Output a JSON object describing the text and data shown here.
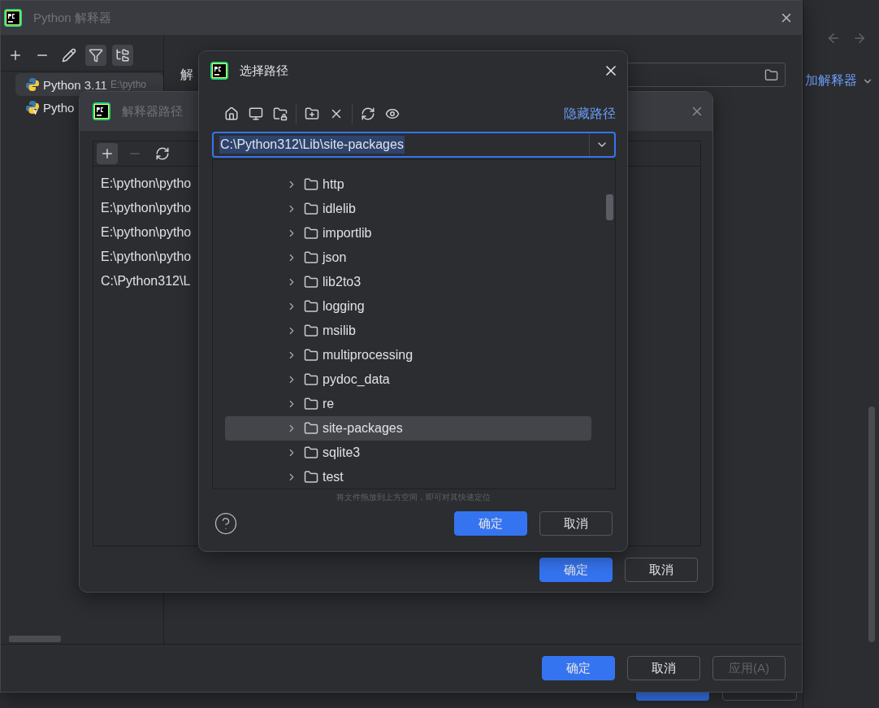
{
  "background": {
    "add_link": "加解释器"
  },
  "main_dialog": {
    "title": "Python 解释器",
    "active": false,
    "toolbar": [
      {
        "kind": "add",
        "selected": false
      },
      {
        "kind": "remove",
        "selected": false
      },
      {
        "kind": "edit",
        "selected": false
      },
      {
        "kind": "filter",
        "selected": true
      },
      {
        "kind": "tree",
        "selected": true
      }
    ],
    "interpreters": [
      {
        "name": "Python 3.11",
        "path": "E:\\pytho",
        "kind": "python",
        "selected": true
      },
      {
        "name": "Pytho",
        "kind": "venv",
        "selected": false
      }
    ],
    "field_label": "解",
    "buttons": [
      {
        "label": "确定",
        "kind": "primary",
        "disabled": false
      },
      {
        "label": "取消",
        "kind": "secondary",
        "disabled": false
      },
      {
        "label": "应用(A)",
        "kind": "secondary",
        "disabled": true
      }
    ]
  },
  "paths_dialog": {
    "title": "解释器路径",
    "active": false,
    "toolbar": [
      {
        "kind": "add",
        "selected": true,
        "disabled": false
      },
      {
        "kind": "remove",
        "selected": false,
        "disabled": true
      },
      {
        "kind": "refresh",
        "selected": false,
        "disabled": false
      }
    ],
    "paths": [
      "E:\\python\\pytho",
      "E:\\python\\pytho",
      "E:\\python\\pytho",
      "E:\\python\\pytho",
      "C:\\Python312\\L"
    ],
    "buttons": [
      {
        "label": "确定",
        "kind": "primary",
        "disabled": false
      },
      {
        "label": "取消",
        "kind": "secondary",
        "disabled": false
      }
    ]
  },
  "select_dialog": {
    "title": "选择路径",
    "active": true,
    "toolbar": [
      {
        "kind": "home"
      },
      {
        "kind": "desktop"
      },
      {
        "kind": "folder-lock"
      },
      {
        "kind": "separator"
      },
      {
        "kind": "new-folder"
      },
      {
        "kind": "delete"
      },
      {
        "kind": "separator"
      },
      {
        "kind": "refresh"
      },
      {
        "kind": "show-hidden"
      }
    ],
    "hide_link": "隐藏路径",
    "path": "C:\\Python312\\Lib\\site-packages",
    "tree": [
      {
        "name": "http",
        "selected": false
      },
      {
        "name": "idlelib",
        "selected": false
      },
      {
        "name": "importlib",
        "selected": false
      },
      {
        "name": "json",
        "selected": false
      },
      {
        "name": "lib2to3",
        "selected": false
      },
      {
        "name": "logging",
        "selected": false
      },
      {
        "name": "msilib",
        "selected": false
      },
      {
        "name": "multiprocessing",
        "selected": false
      },
      {
        "name": "pydoc_data",
        "selected": false
      },
      {
        "name": "re",
        "selected": false
      },
      {
        "name": "site-packages",
        "selected": true
      },
      {
        "name": "sqlite3",
        "selected": false
      },
      {
        "name": "test",
        "selected": false
      }
    ],
    "hint": "将文件拖放到上方空间，即可对其快速定位",
    "buttons": [
      {
        "label": "确定",
        "kind": "primary",
        "disabled": false
      },
      {
        "label": "取消",
        "kind": "secondary",
        "disabled": false
      }
    ]
  }
}
